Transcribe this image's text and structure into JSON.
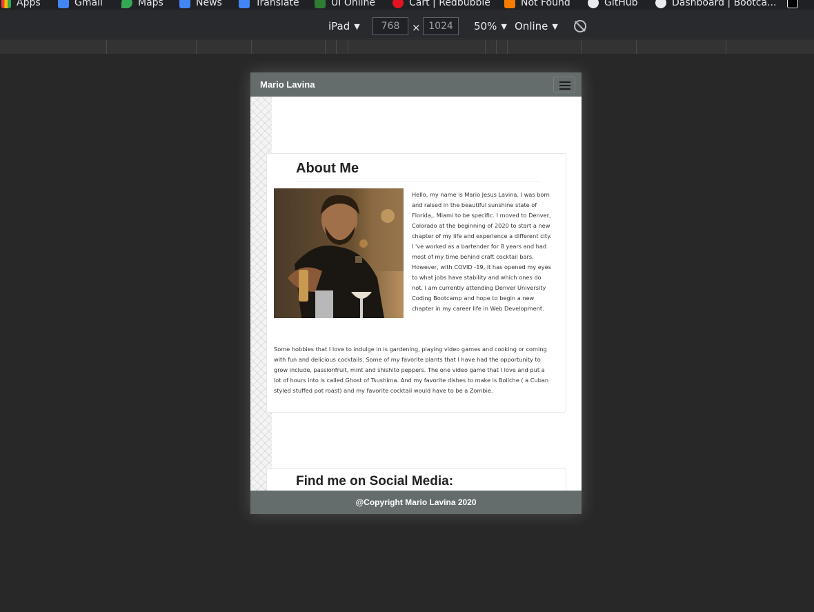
{
  "bookmarks": {
    "items": [
      {
        "label": "Apps",
        "icon": "apps-grid-icon",
        "color": "#ea4335"
      },
      {
        "label": "Gmail",
        "icon": "gmail-icon",
        "color": "#4285f4"
      },
      {
        "label": "Maps",
        "icon": "maps-pin-icon",
        "color": "#34a853"
      },
      {
        "label": "News",
        "icon": "news-icon",
        "color": "#4285f4"
      },
      {
        "label": "Translate",
        "icon": "translate-icon",
        "color": "#4285f4"
      },
      {
        "label": "UI Online",
        "icon": "ui-online-icon",
        "color": "#2e7d32"
      },
      {
        "label": "Cart | Redbubble",
        "icon": "redbubble-icon",
        "color": "#e41321"
      },
      {
        "label": "Not Found",
        "icon": "not-found-icon",
        "color": "#f57c00"
      },
      {
        "label": "GitHub",
        "icon": "github-icon",
        "color": "#ffffff"
      },
      {
        "label": "Dashboard | Bootca...",
        "icon": "bootcamp-icon",
        "color": "#ffffff"
      }
    ]
  },
  "device_toolbar": {
    "device": "iPad",
    "width": "768",
    "times": "×",
    "height": "1024",
    "zoom": "50%",
    "network": "Online",
    "dropdown_glyph": "▼"
  },
  "site": {
    "brand": "Mario Lavina",
    "about": {
      "title": "About Me",
      "bio": "Hello, my name is Mario Jesus Lavina. I was born and raised in the beautiful sunshine state of Florida,. Miami to be specific. I moved to Denver, Colorado at the beginning of 2020 to start a new chapter of my life and experience a different city. I 've worked as a bartender for 8 years and had most of my time behind craft cocktail bars. However, with COVID -19, it has opened my eyes to what jobs have stability and which ones do not. I am currently attending Denver University Coding Bootcamp and hope to begin a new chapter in my career life in Web Development.",
      "hobbies": "Some hobbies that I love to indulge in is gardening, playing video games and cooking or coming with fun and delicious cocktails. Some of my favorite plants that I have had the opportunity to grow include, passionfruit, mint and shishito peppers. The one video game that I love and put a lot of hours into is called Ghost of Tsushima. And my favorite dishes to make is Boliche ( a Cuban styled stuffed pot roast) and my favorite cocktail would have to be a Zombie."
    },
    "social": {
      "title": "Find me on Social Media:"
    },
    "footer": "@Copyright Mario Lavina 2020"
  }
}
